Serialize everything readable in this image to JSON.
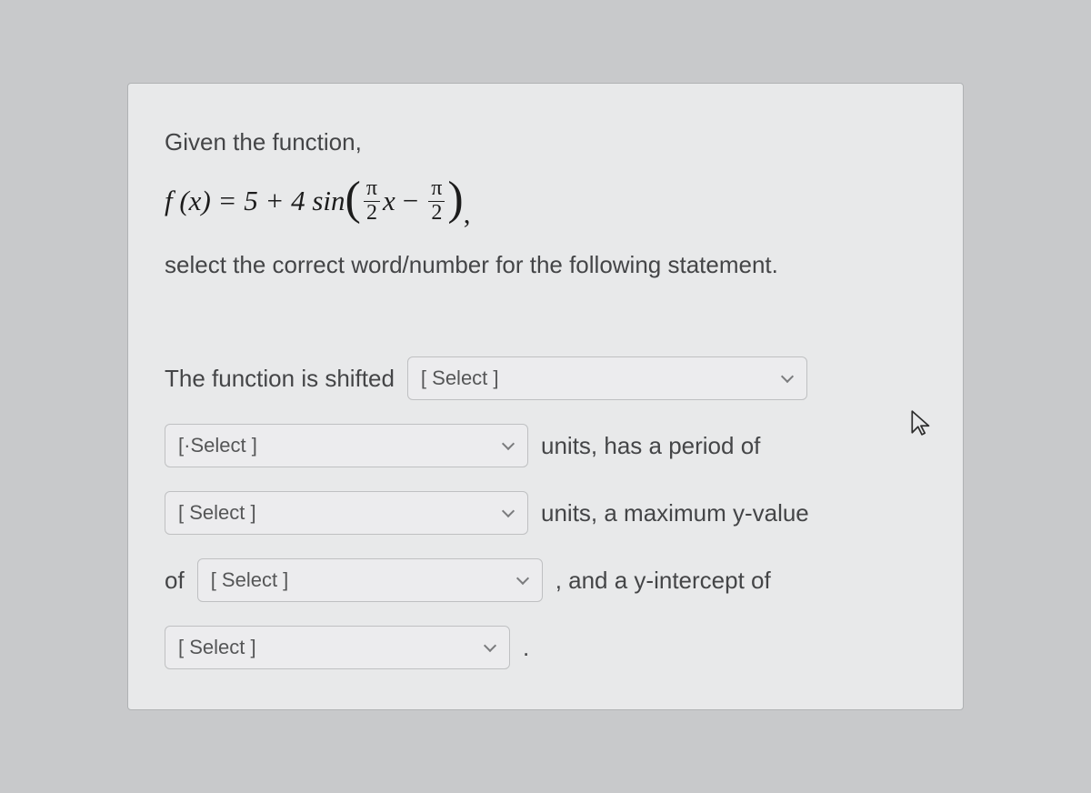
{
  "intro_text": "Given the function,",
  "formula": {
    "lhs": "f (x) = 5 + 4 sin",
    "frac1_num": "π",
    "frac1_den": "2",
    "var": "x",
    "minus": "−",
    "frac2_num": "π",
    "frac2_den": "2",
    "comma": ","
  },
  "desc_text": "select the correct word/number for the following statement.",
  "row1_lead": "The function is shifted",
  "row2_trail": "units, has a period of",
  "row3_trail": "units, a maximum y-value",
  "row4_lead": "of",
  "row4_trail": ", and a y-intercept of",
  "row5_trail": ".",
  "select_placeholder": "[ Select ]",
  "select_placeholder_dot": "[·Select ]"
}
